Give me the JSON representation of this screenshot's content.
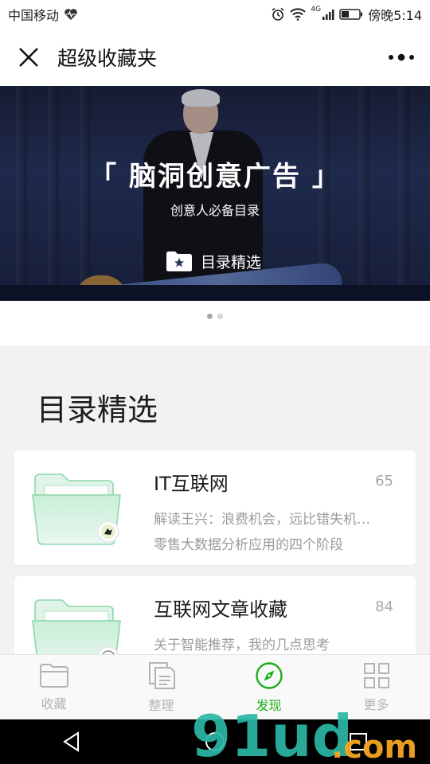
{
  "status_bar": {
    "carrier": "中国移动",
    "network": "4G",
    "time": "傍晚5:14"
  },
  "header": {
    "title": "超级收藏夹"
  },
  "banner": {
    "title": "「 脑洞创意广告 」",
    "subtitle": "创意人必备目录",
    "tag": "目录精选",
    "page_count": 2,
    "active_page": 1
  },
  "section": {
    "heading": "目录精选"
  },
  "cards": [
    {
      "title": "IT互联网",
      "count": "65",
      "line1": "解读王兴：浪费机会，远比错失机…",
      "line2": "零售大数据分析应用的四个阶段"
    },
    {
      "title": "互联网文章收藏",
      "count": "84",
      "line1": "关于智能推荐，我的几点思考",
      "line2": ""
    }
  ],
  "tabs": [
    {
      "label": "收藏",
      "icon": "folder-icon",
      "active": false
    },
    {
      "label": "整理",
      "icon": "documents-icon",
      "active": false
    },
    {
      "label": "发现",
      "icon": "compass-icon",
      "active": true
    },
    {
      "label": "更多",
      "icon": "grid-icon",
      "active": false
    }
  ],
  "watermark": {
    "text": "91ud.com"
  },
  "colors": {
    "accent": "#1aad19",
    "inactive": "#b4b4b4",
    "folder_green": "#8ed6ac"
  }
}
